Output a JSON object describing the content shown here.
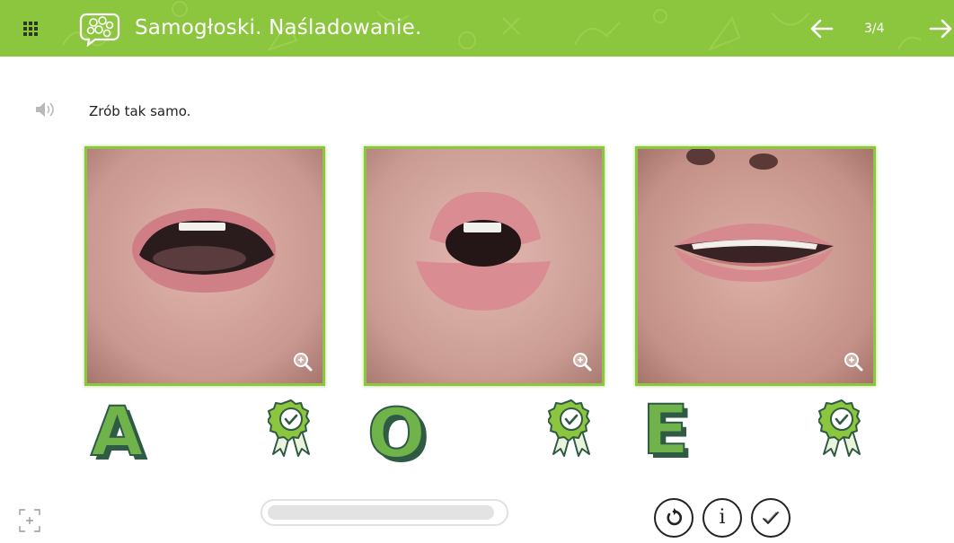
{
  "header": {
    "title": "Samogłoski. Naśladowanie.",
    "page_indicator": "3/4",
    "menu_icon": "grid-icon",
    "logo_icon": "speech-bubble-icon",
    "prev_icon": "arrow-left-icon",
    "next_icon": "arrow-right-icon",
    "background_color": "#8cc63f"
  },
  "instruction": {
    "text": "Zrób tak samo.",
    "audio_icon": "speaker-icon"
  },
  "cards": [
    {
      "letter": "A",
      "status_icon": "check-badge-icon",
      "zoom_icon": "zoom-in-icon",
      "mouth_shape": "open"
    },
    {
      "letter": "O",
      "status_icon": "check-badge-icon",
      "zoom_icon": "zoom-in-icon",
      "mouth_shape": "round"
    },
    {
      "letter": "E",
      "status_icon": "check-badge-icon",
      "zoom_icon": "zoom-in-icon",
      "mouth_shape": "wide"
    }
  ],
  "footer": {
    "fullscreen_icon": "fullscreen-icon",
    "progress": 0.97,
    "reset_icon": "reset-icon",
    "info_label": "i",
    "check_icon": "check-icon"
  },
  "colors": {
    "accent": "#8cc63f",
    "letter_fill": "#6fb34a",
    "letter_shadow": "#2f5a44"
  }
}
